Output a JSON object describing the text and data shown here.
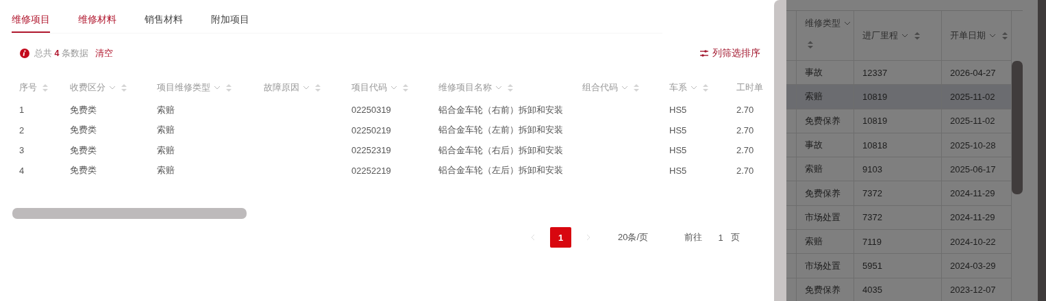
{
  "tabs": [
    {
      "label": "维修项目",
      "selected": true,
      "hovered": false
    },
    {
      "label": "维修材料",
      "selected": false,
      "hovered": true
    },
    {
      "label": "销售材料",
      "selected": false,
      "hovered": false
    },
    {
      "label": "附加项目",
      "selected": false,
      "hovered": false
    }
  ],
  "summary": {
    "text": "总共 **4** 条数据",
    "clear_link": "清空"
  },
  "column_filter_button": "列筛选排序",
  "table": {
    "columns": [
      {
        "label": "序号",
        "filter": false,
        "sortable": true
      },
      {
        "label": "收费区分",
        "filter": true,
        "sortable": true
      },
      {
        "label": "项目维修类型",
        "filter": true,
        "sortable": true
      },
      {
        "label": "故障原因",
        "filter": true,
        "sortable": true
      },
      {
        "label": "项目代码",
        "filter": true,
        "sortable": true
      },
      {
        "label": "维修项目名称",
        "filter": true,
        "sortable": true
      },
      {
        "label": "组合代码",
        "filter": true,
        "sortable": true
      },
      {
        "label": "车系",
        "filter": true,
        "sortable": true
      },
      {
        "label": "工时单"
      }
    ],
    "rows": [
      [
        "1",
        "免费类",
        "索赔",
        null,
        "02250319",
        "铝合金车轮（右前）拆卸和安装",
        null,
        "HS5",
        "2.70"
      ],
      [
        "2",
        "免费类",
        "索赔",
        null,
        "02250219",
        "铝合金车轮（左前）拆卸和安装",
        null,
        "HS5",
        "2.70"
      ],
      [
        "3",
        "免费类",
        "索赔",
        null,
        "02252319",
        "铝合金车轮（右后）拆卸和安装",
        null,
        "HS5",
        "2.70"
      ],
      [
        "4",
        "免费类",
        "索赔",
        null,
        "02252219",
        "铝合金车轮（左后）拆卸和安装",
        null,
        "HS5",
        "2.70"
      ]
    ]
  },
  "pagination": {
    "prev_disabled": true,
    "next_disabled": true,
    "pages": [
      {
        "label": "1",
        "selected": true
      }
    ],
    "page_size": "20条/页",
    "goto_label": "前往",
    "goto_value": "1",
    "page_suffix": "页"
  },
  "background_table": {
    "columns": [
      {
        "label": "维修类型",
        "filter": true,
        "sortable": true,
        "wrapped": true
      },
      {
        "label": "进厂里程",
        "filter": true,
        "sortable": true,
        "wrapped": false
      },
      {
        "label": "开单日期",
        "filter": true,
        "sortable": true,
        "wrapped": false
      }
    ],
    "rows": [
      {
        "cells": [
          "事故",
          "12337",
          "2026-04-27"
        ],
        "selected": false
      },
      {
        "cells": [
          "索赔",
          "10819",
          "2025-11-02"
        ],
        "selected": true
      },
      {
        "cells": [
          "免费保养",
          "10819",
          "2025-11-02"
        ],
        "selected": false
      },
      {
        "cells": [
          "事故",
          "10818",
          "2025-10-28"
        ],
        "selected": false
      },
      {
        "cells": [
          "索赔",
          "9103",
          "2025-06-17"
        ],
        "selected": false
      },
      {
        "cells": [
          "免费保养",
          "7372",
          "2024-11-29"
        ],
        "selected": false
      },
      {
        "cells": [
          "市场处置",
          "7372",
          "2024-11-29"
        ],
        "selected": false
      },
      {
        "cells": [
          "索赔",
          "7119",
          "2024-10-22"
        ],
        "selected": false
      },
      {
        "cells": [
          "市场处置",
          "5951",
          "2024-03-29"
        ],
        "selected": false
      },
      {
        "cells": [
          "免费保养",
          "4035",
          "2023-12-07"
        ],
        "selected": false
      }
    ]
  }
}
